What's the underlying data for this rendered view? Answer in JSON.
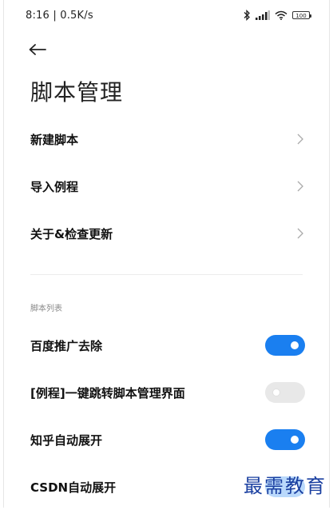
{
  "status_bar": {
    "time_speed": "8:16 | 0.5K/s",
    "battery": "100"
  },
  "header": {
    "title": "脚本管理"
  },
  "menu": [
    {
      "label": "新建脚本"
    },
    {
      "label": "导入例程"
    },
    {
      "label": "关于&检查更新"
    }
  ],
  "section": {
    "header": "脚本列表"
  },
  "scripts": [
    {
      "label": "百度推广去除",
      "enabled": true
    },
    {
      "label": "[例程]一键跳转脚本管理界面",
      "enabled": false
    },
    {
      "label": "知乎自动展开",
      "enabled": true
    },
    {
      "label": "CSDN自动展开",
      "enabled": true
    }
  ],
  "watermark": "最需教育",
  "colors": {
    "accent": "#1a7ff0",
    "toggle_off": "#e8e8e8",
    "watermark": "#1a3fa0"
  }
}
